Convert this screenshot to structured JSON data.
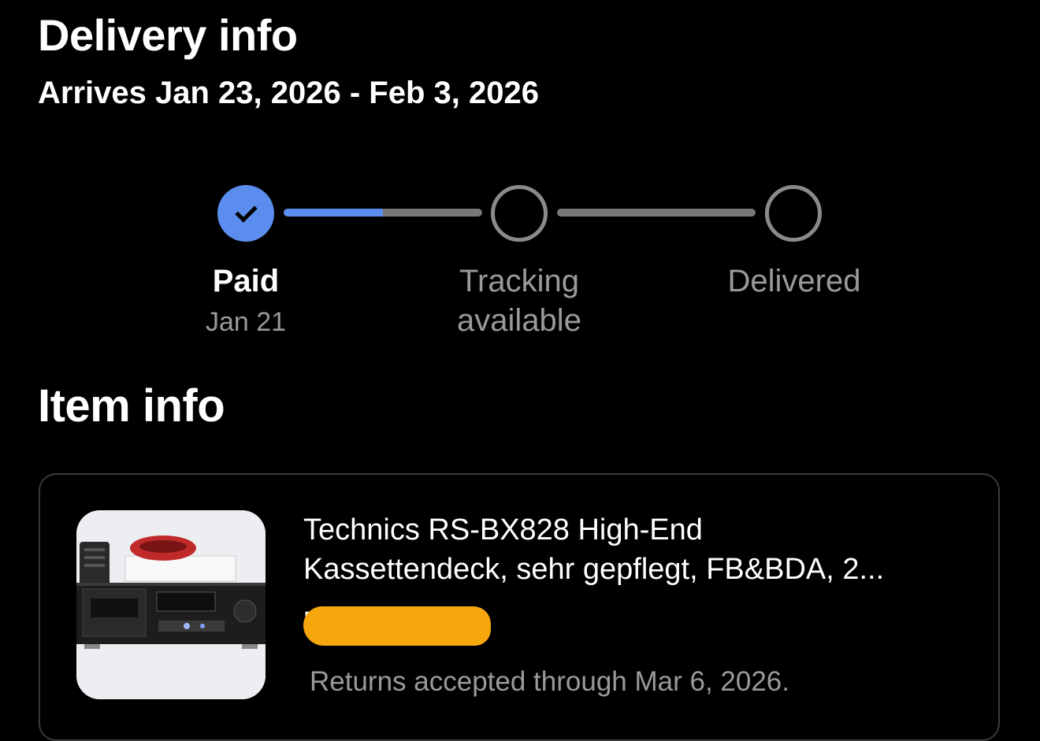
{
  "delivery": {
    "heading": "Delivery info",
    "arrives": "Arrives Jan 23, 2026 - Feb 3, 2026"
  },
  "tracker": {
    "steps": [
      {
        "label": "Paid",
        "date": "Jan 21",
        "state": "completed"
      },
      {
        "label_line1": "Tracking",
        "label_line2": "available",
        "state": "pending"
      },
      {
        "label": "Delivered",
        "state": "pending"
      }
    ],
    "segment_progress": [
      0.5,
      0.0
    ],
    "colors": {
      "active": "#5b8def",
      "inactive": "#8a8a8a"
    }
  },
  "item": {
    "heading": "Item info",
    "title_line1": "Technics RS-BX828 High-End",
    "title_line2": "Kassettendeck, sehr gepflegt, FB&BDA, 2...",
    "price_visible_fragment": "E",
    "price_redacted": true,
    "redaction_color": "#f7a70e",
    "returns": "Returns accepted through Mar 6, 2026."
  }
}
